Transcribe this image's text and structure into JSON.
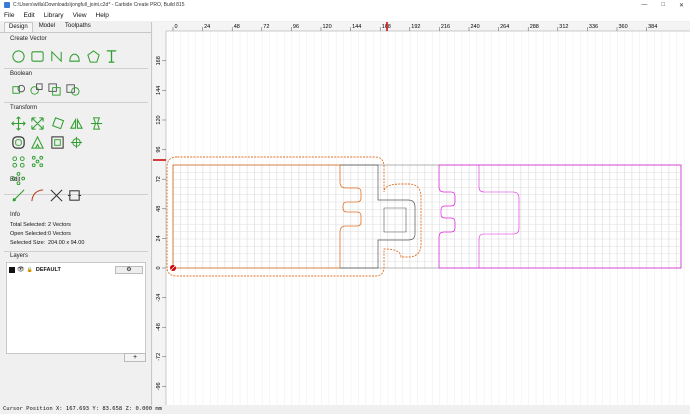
{
  "window": {
    "title": "C:\\Users\\willa\\Downloads\\jongfull_joint.c2d* - Carbide Create PRO, Build 815",
    "controls": [
      "—",
      "□",
      "✕"
    ]
  },
  "menu": [
    "File",
    "Edit",
    "Library",
    "View",
    "Help"
  ],
  "tabs": [
    "Design",
    "Model",
    "Toolpaths"
  ],
  "sections": {
    "create_vector": "Create Vector",
    "boolean": "Boolean",
    "transform": "Transform",
    "edit": "Edit",
    "info": "Info",
    "layers": "Layers"
  },
  "info": {
    "total_selected_label": "Total Selected:",
    "total_selected_value": "2 Vectors",
    "open_selected_label": "Open Selected:",
    "open_selected_value": "0 Vectors",
    "selected_size_label": "Selected Size:",
    "selected_size_value": "204.00 x 94.00"
  },
  "layers": {
    "items": [
      {
        "name": "DEFAULT",
        "color": "#111111"
      }
    ],
    "add_label": "+"
  },
  "ruler": {
    "x_ticks": [
      "0",
      "24",
      "48",
      "72",
      "96",
      "120",
      "144",
      "168",
      "192",
      "216",
      "240",
      "264",
      "288",
      "312",
      "336",
      "360",
      "384"
    ],
    "y_ticks": [
      "168",
      "144",
      "120",
      "96",
      "72",
      "48",
      "24",
      "0",
      "-24",
      "-48",
      "-72",
      "-96"
    ]
  },
  "status": {
    "cursor": "Cursor Position X: 167.693 Y: 83.658 Z: 0.000 mm"
  },
  "colors": {
    "selection_orange": "#e07020",
    "magenta": "#e020e0",
    "grid": "#dddddd",
    "tool_green": "#2e9e2e",
    "marker_red": "#cc0000"
  },
  "icons": {
    "create_vector": [
      "circle-icon",
      "rectangle-icon",
      "polyline-icon",
      "curve-icon",
      "polygon-icon",
      "text-icon"
    ],
    "boolean": [
      "union-icon",
      "subtract-icon",
      "intersect-icon",
      "weld-icon"
    ],
    "transform": [
      "move-icon",
      "scale-icon",
      "rotate-icon",
      "mirror-icon",
      "align-icon",
      "offset-icon",
      "outline-icon",
      "box-icon",
      "node-icon",
      "pattern-icon",
      "array-icon",
      "circular-array-icon"
    ],
    "edit": [
      "node-edit-icon",
      "curve-edit-icon",
      "trim-icon",
      "join-icon"
    ]
  }
}
